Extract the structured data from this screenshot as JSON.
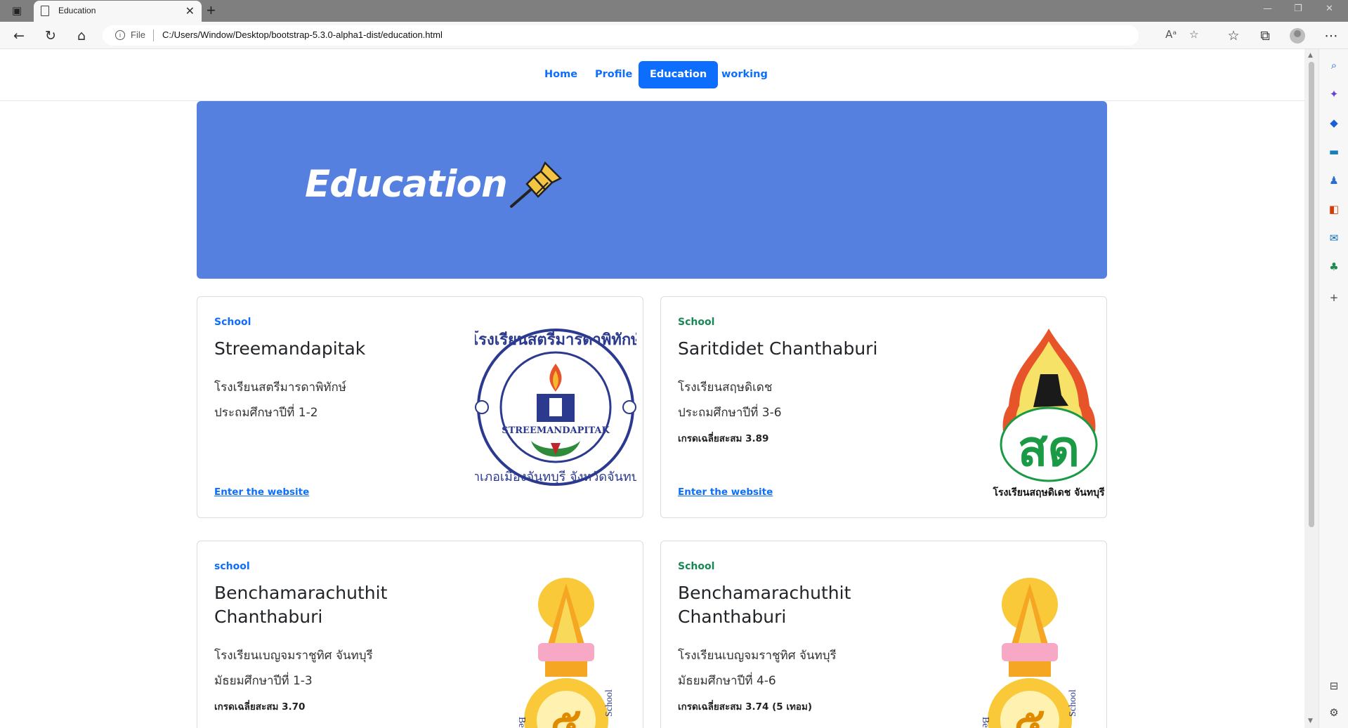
{
  "browser": {
    "tab_title": "Education",
    "address_scheme": "File",
    "address_url": "C:/Users/Window/Desktop/bootstrap-5.3.0-alpha1-dist/education.html"
  },
  "nav": {
    "items": [
      {
        "label": "Home",
        "active": false
      },
      {
        "label": "Profile",
        "active": false
      },
      {
        "label": "Education",
        "active": true
      },
      {
        "label": "working",
        "active": false
      }
    ]
  },
  "hero": {
    "title": "Education",
    "background": "#5580e0"
  },
  "colors": {
    "primary": "#0d6efd",
    "success": "#198754"
  },
  "cards": [
    {
      "category": "School",
      "category_color": "#0d6efd",
      "title": "Streemandapitak",
      "line1": "โรงเรียนสตรีมารดาพิทักษ์",
      "line2": "ประถมศึกษาปีที่ 1-2",
      "gpa": "",
      "link": "Enter the website",
      "logo_text": "STREEMANDAPITAK"
    },
    {
      "category": "School",
      "category_color": "#198754",
      "title": "Saritdidet Chanthaburi",
      "line1": "โรงเรียนสฤษดิเดช",
      "line2": "ประถมศึกษาปีที่ 3-6",
      "gpa": "เกรดเฉลี่ยสะสม 3.89",
      "link": "Enter the website",
      "logo_text": "สด"
    },
    {
      "category": "school",
      "category_color": "#0d6efd",
      "title": "Benchamarachuthit Chanthaburi",
      "line1": "โรงเรียนเบญจมราชูทิศ จันทบุรี",
      "line2": "มัธยมศึกษาปีที่ 1-3",
      "gpa": "เกรดเฉลี่ยสะสม 3.70",
      "link": "",
      "logo_text": "๕"
    },
    {
      "category": "School",
      "category_color": "#198754",
      "title": "Benchamarachuthit Chanthaburi",
      "line1": "โรงเรียนเบญจมราชูทิศ จันทบุรี",
      "line2": "มัธยมศึกษาปีที่ 4-6",
      "gpa": "เกรดเฉลี่ยสะสม 3.74 (5 เทอม)",
      "link": "",
      "logo_text": "๕"
    }
  ]
}
